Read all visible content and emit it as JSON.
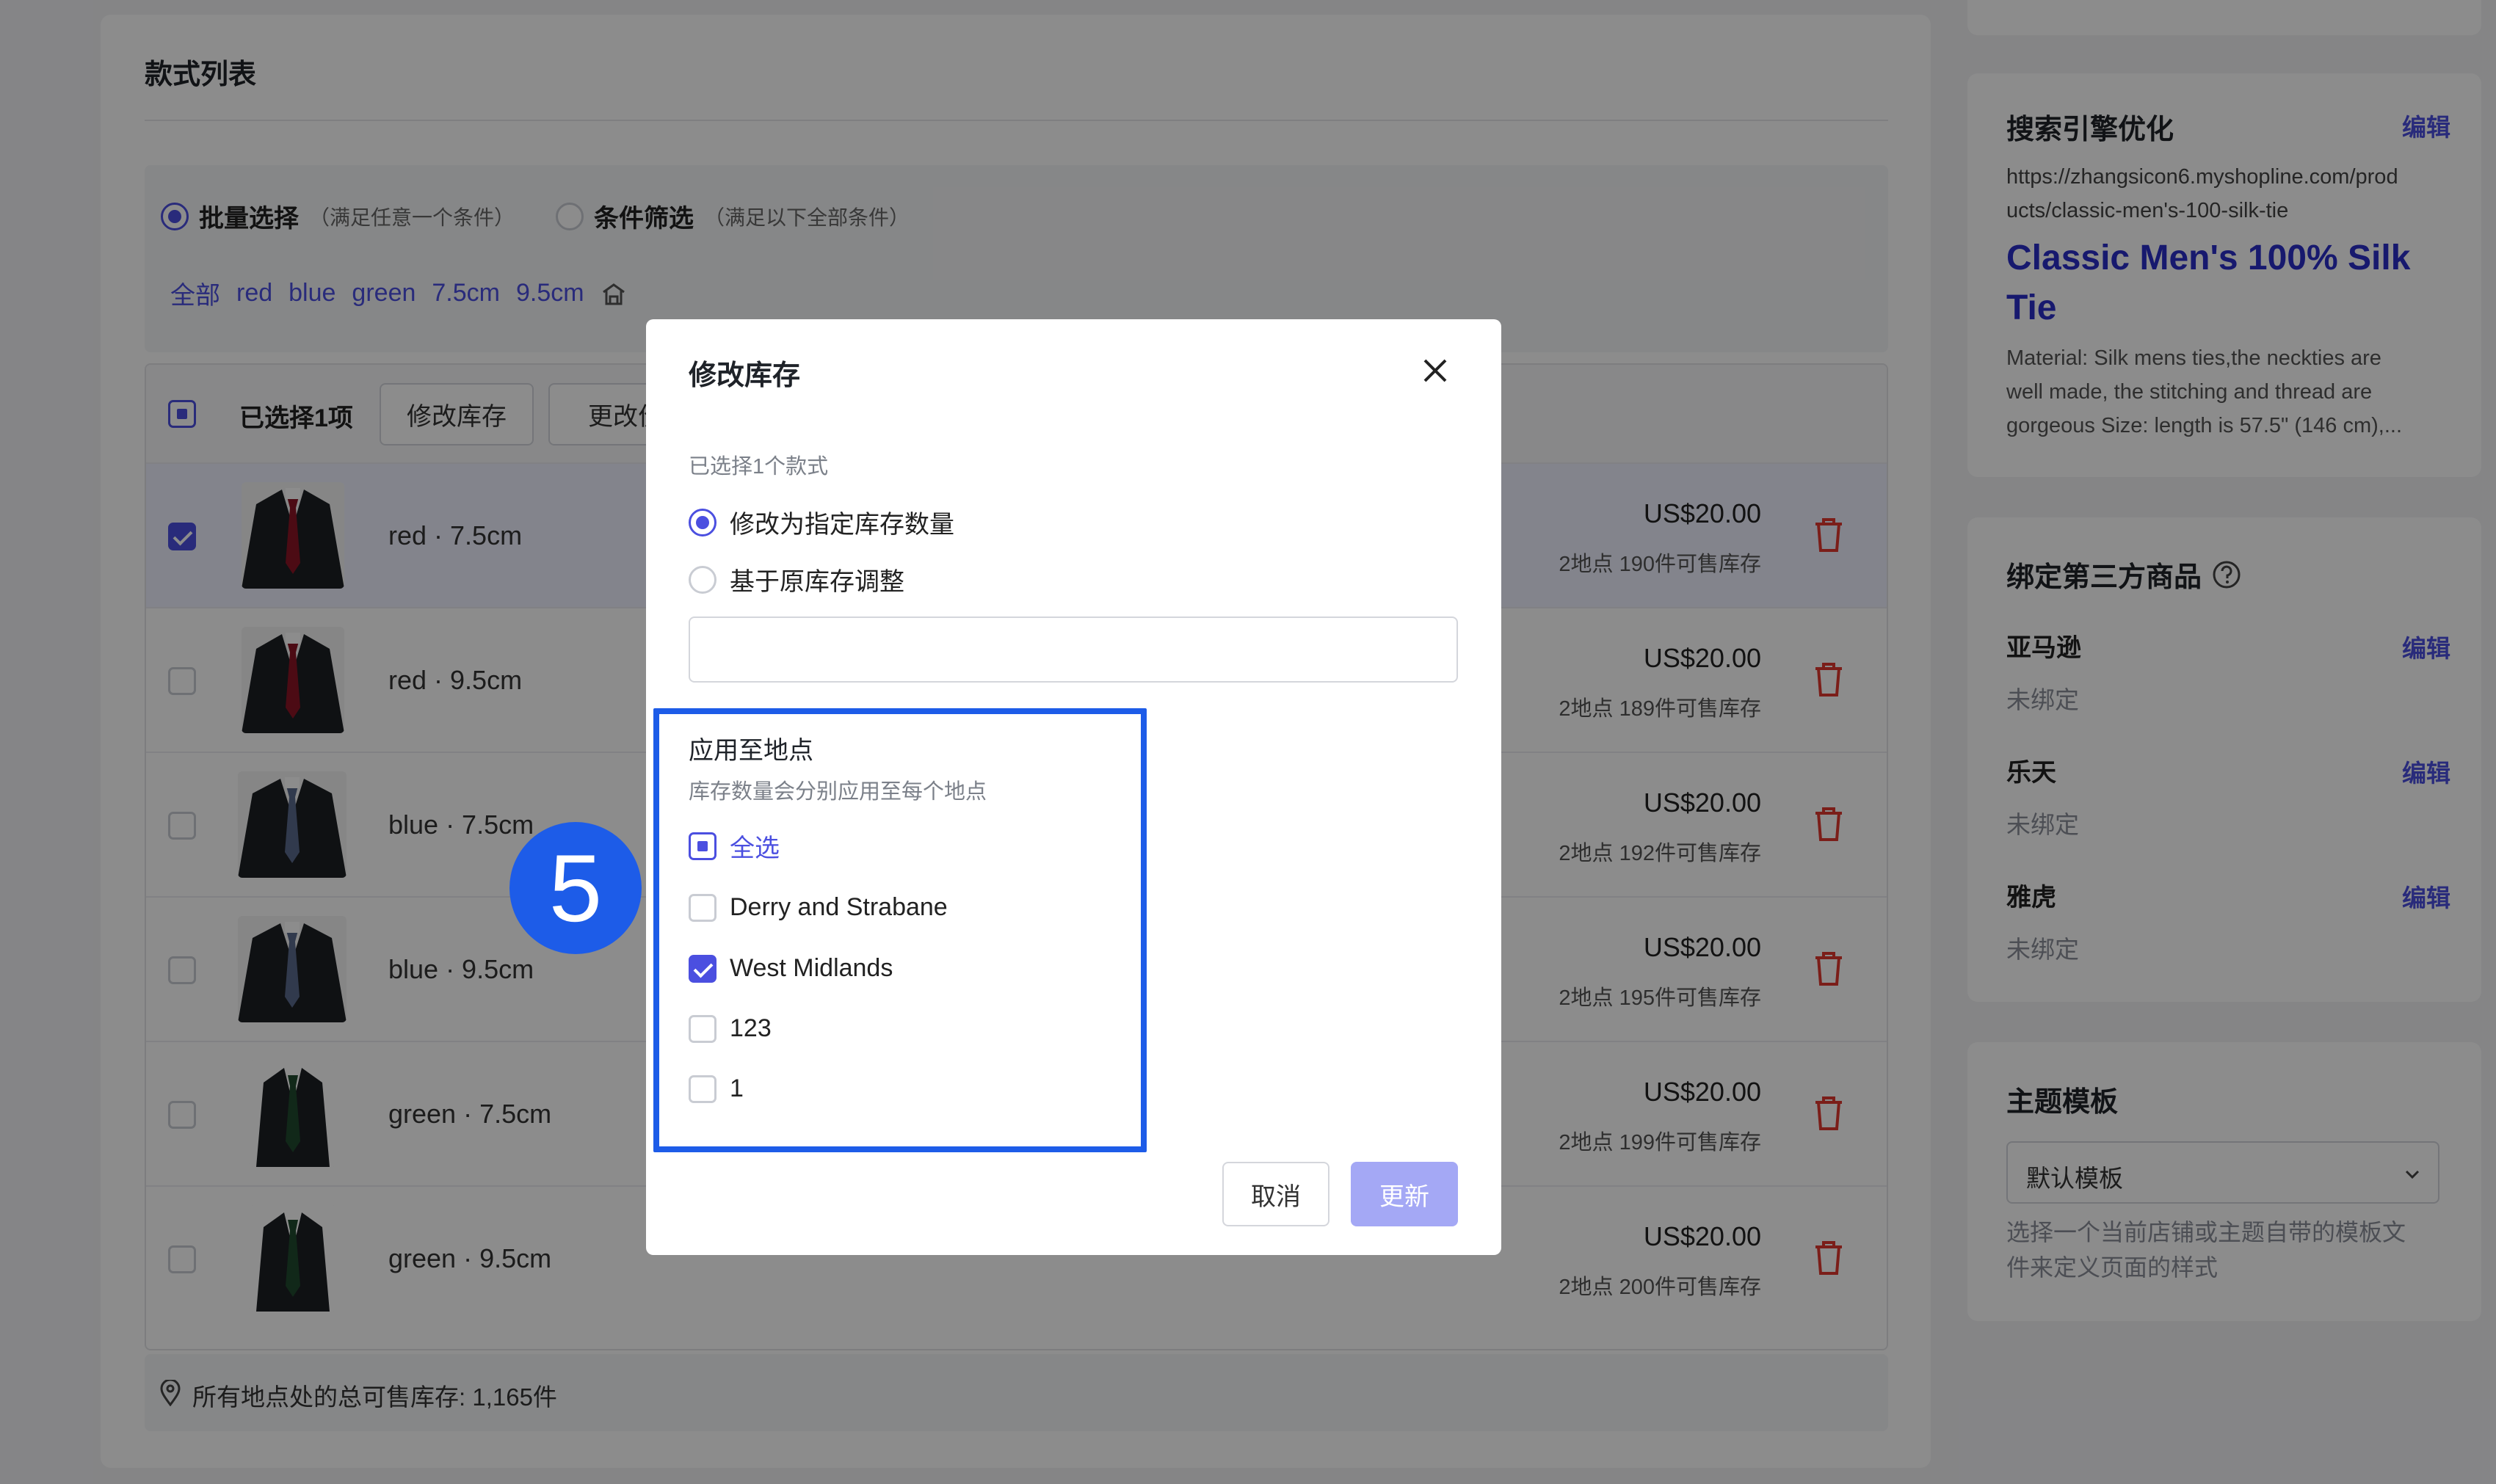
{
  "variants_card": {
    "title": "款式列表",
    "filter_mode_batch": "批量选择",
    "filter_mode_batch_hint": "（满足任意一个条件）",
    "filter_mode_cond": "条件筛选",
    "filter_mode_cond_hint": "（满足以下全部条件）",
    "tags": [
      "全部",
      "red",
      "blue",
      "green",
      "7.5cm",
      "9.5cm"
    ],
    "selected_count": "已选择1项",
    "btn_modify_stock": "修改库存",
    "btn_modify_price": "更改价",
    "rows": [
      {
        "name": "red · 7.5cm",
        "price": "US$20.00",
        "stock": "2地点 190件可售库存",
        "checked": true
      },
      {
        "name": "red · 9.5cm",
        "price": "US$20.00",
        "stock": "2地点 189件可售库存",
        "checked": false
      },
      {
        "name": "blue · 7.5cm",
        "price": "US$20.00",
        "stock": "2地点 192件可售库存",
        "checked": false
      },
      {
        "name": "blue · 9.5cm",
        "price": "US$20.00",
        "stock": "2地点 195件可售库存",
        "checked": false
      },
      {
        "name": "green · 7.5cm",
        "price": "US$20.00",
        "stock": "2地点 199件可售库存",
        "checked": false
      },
      {
        "name": "green · 9.5cm",
        "price": "US$20.00",
        "stock": "2地点 200件可售库存",
        "checked": false
      }
    ],
    "total_stock": "所有地点处的总可售库存: 1,165件"
  },
  "seo": {
    "title": "搜索引擎优化",
    "edit": "编辑",
    "url_line1": "https://zhangsicon6.myshopline.com/prod",
    "url_line2": "ucts/classic-men's-100-silk-tie",
    "page_title_line1": "Classic Men's 100% Silk",
    "page_title_line2": "Tie",
    "desc_line1": "Material: Silk mens ties,the neckties are",
    "desc_line2": "well made, the stitching and thread are",
    "desc_line3": "gorgeous Size: length is 57.5\" (146 cm),..."
  },
  "third_party": {
    "title": "绑定第三方商品",
    "items": [
      {
        "name": "亚马逊",
        "edit": "编辑",
        "status": "未绑定"
      },
      {
        "name": "乐天",
        "edit": "编辑",
        "status": "未绑定"
      },
      {
        "name": "雅虎",
        "edit": "编辑",
        "status": "未绑定"
      }
    ]
  },
  "theme": {
    "title": "主题模板",
    "select_value": "默认模板",
    "hint_line1": "选择一个当前店铺或主题自带的模板文",
    "hint_line2": "件来定义页面的样式"
  },
  "modal": {
    "title": "修改库存",
    "selected_info": "已选择1个款式",
    "opt_set": "修改为指定库存数量",
    "opt_adjust": "基于原库存调整",
    "quantity_value": "",
    "apply_title": "应用至地点",
    "apply_hint": "库存数量会分别应用至每个地点",
    "select_all": "全选",
    "locations": [
      {
        "name": "Derry and Strabane",
        "checked": false
      },
      {
        "name": "West Midlands",
        "checked": true
      },
      {
        "name": "123",
        "checked": false
      },
      {
        "name": "1",
        "checked": false
      }
    ],
    "cancel": "取消",
    "update": "更新"
  },
  "step_badge": "5",
  "colors": {
    "accent": "#4b4fe0",
    "highlight": "#1d5ce8",
    "danger": "#e0382f"
  }
}
